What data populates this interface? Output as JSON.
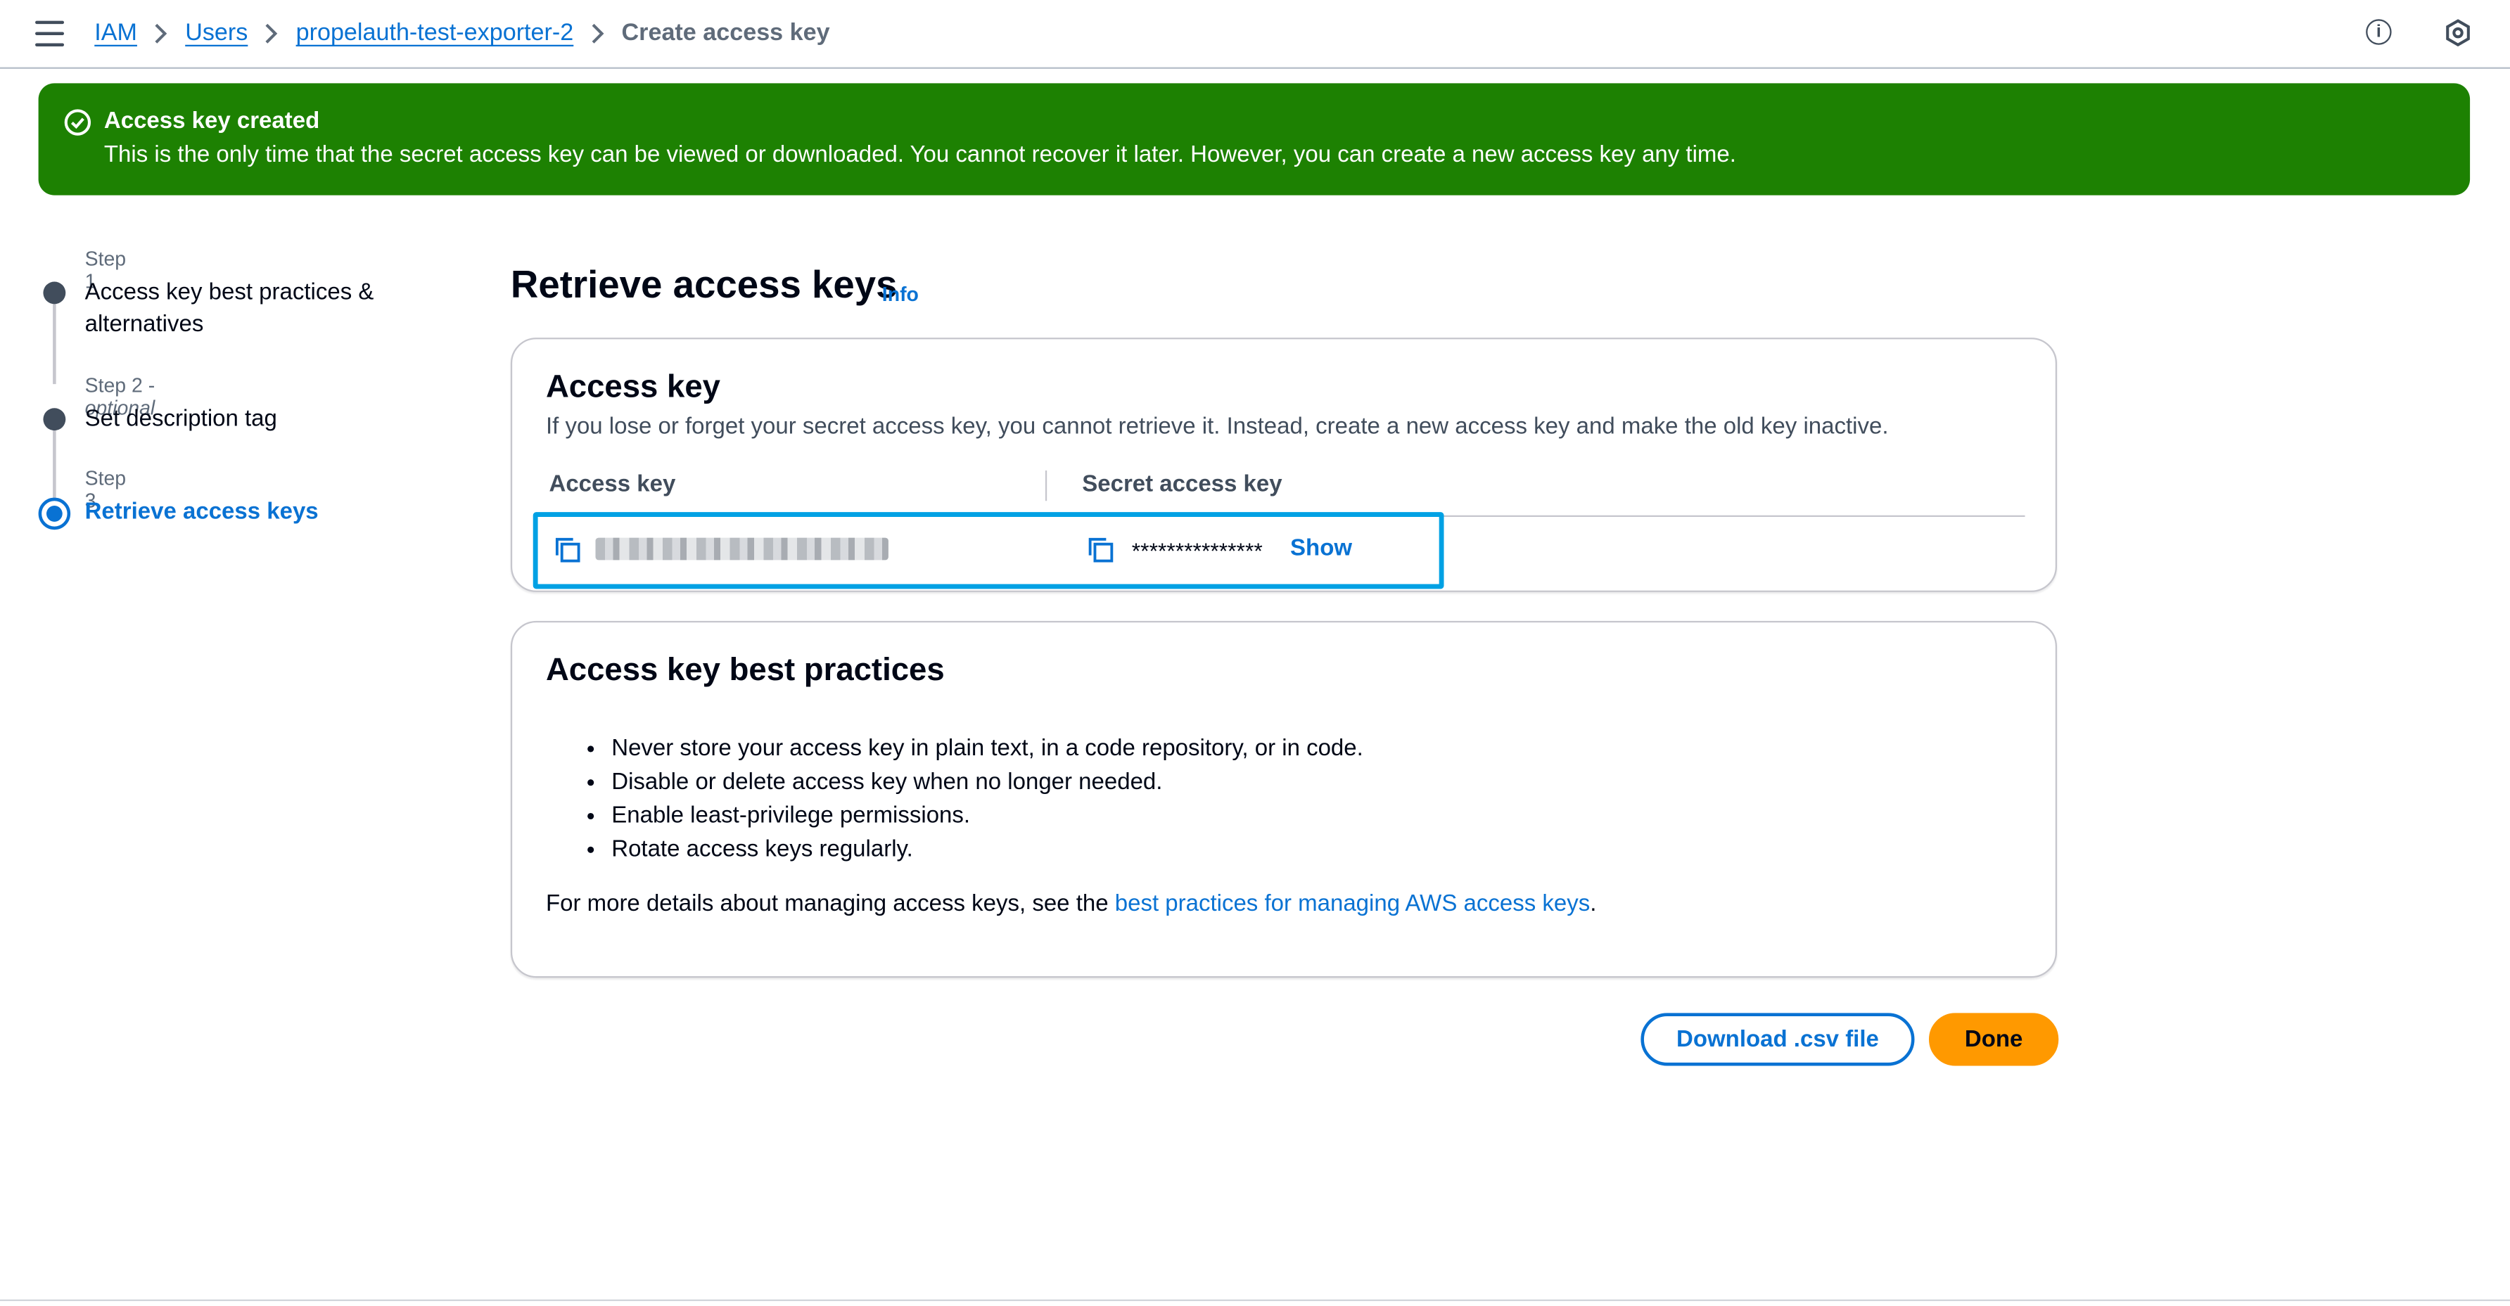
{
  "breadcrumb": {
    "items": [
      "IAM",
      "Users",
      "propelauth-test-exporter-2"
    ],
    "current": "Create access key"
  },
  "icons": {
    "menu": "hamburger-menu-icon",
    "info": "info-circle-icon",
    "settings": "settings-icon",
    "success": "check-circle-icon",
    "copy": "copy-icon"
  },
  "colors": {
    "flash_success": "#1d8102",
    "link": "#0972d3",
    "primary_button": "#ff9900",
    "highlight": "#00a1e4"
  },
  "flash": {
    "title": "Access key created",
    "message": "This is the only time that the secret access key can be viewed or downloaded. You cannot recover it later. However, you can create a new access key any time."
  },
  "steps": [
    {
      "number": "Step 1",
      "optional": "",
      "label": "Access key best practices & alternatives",
      "active": false
    },
    {
      "number": "Step 2",
      "optional": "optional",
      "label": "Set description tag",
      "active": false
    },
    {
      "number": "Step 3",
      "optional": "",
      "label": "Retrieve access keys",
      "active": true
    }
  ],
  "page": {
    "title": "Retrieve access keys",
    "info_link": "Info"
  },
  "access_key_card": {
    "title": "Access key",
    "description": "If you lose or forget your secret access key, you cannot retrieve it. Instead, create a new access key and make the old key inactive.",
    "columns": [
      "Access key",
      "Secret access key"
    ],
    "secret_masked": "***************",
    "show_label": "Show"
  },
  "best_practices_card": {
    "title": "Access key best practices",
    "items": [
      "Never store your access key in plain text, in a code repository, or in code.",
      "Disable or delete access key when no longer needed.",
      "Enable least-privilege permissions.",
      "Rotate access keys regularly."
    ],
    "footer_prefix": "For more details about managing access keys, see the ",
    "footer_link": "best practices for managing AWS access keys",
    "footer_suffix": "."
  },
  "actions": {
    "download": "Download .csv file",
    "done": "Done"
  }
}
